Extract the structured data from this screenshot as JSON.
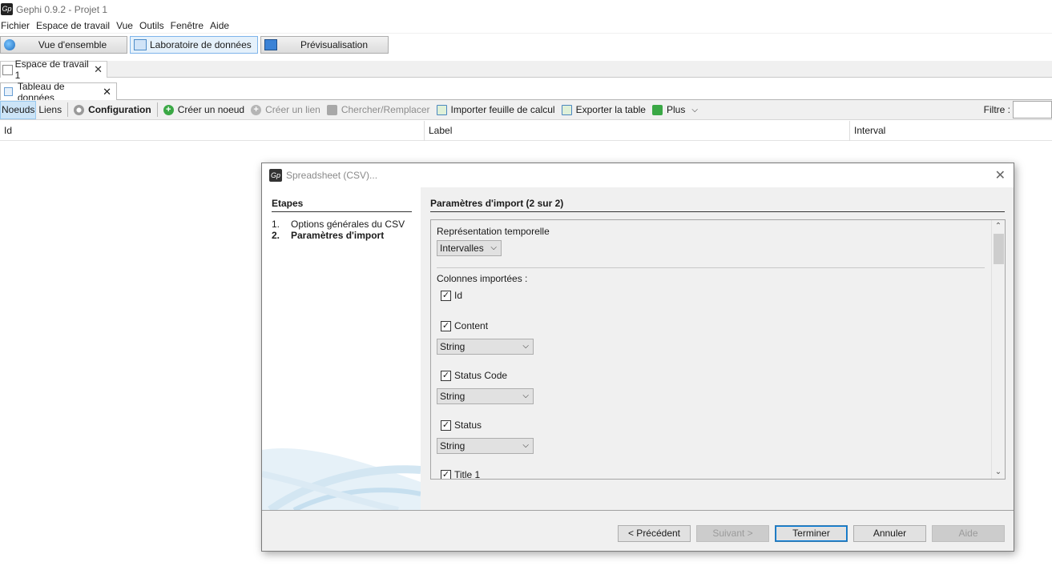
{
  "window": {
    "title": "Gephi 0.9.2 - Projet 1",
    "logo_text": "Gp"
  },
  "menu": [
    "Fichier",
    "Espace de travail",
    "Vue",
    "Outils",
    "Fenêtre",
    "Aide"
  ],
  "perspectives": [
    "Vue d'ensemble",
    "Laboratoire de données",
    "Prévisualisation"
  ],
  "workspace_tab": "Espace de travail 1",
  "data_tab": "Tableau de données",
  "toolbar": {
    "nodes": "Noeuds",
    "edges": "Liens",
    "configuration": "Configuration",
    "create_node": "Créer un noeud",
    "create_edge": "Créer un lien",
    "search_replace": "Chercher/Remplacer",
    "import_sheet": "Importer feuille de calcul",
    "export_table": "Exporter la table",
    "more": "Plus",
    "filter_label": "Filtre :"
  },
  "table_columns": [
    "Id",
    "Label",
    "Interval"
  ],
  "dialog": {
    "title": "Spreadsheet (CSV)...",
    "logo_text": "Gp",
    "steps_title": "Etapes",
    "steps": [
      {
        "num": "1.",
        "label": "Options générales du CSV"
      },
      {
        "num": "2.",
        "label": "Paramètres d'import"
      }
    ],
    "params_title": "Paramètres d'import (2 sur 2)",
    "temporal_label": "Représentation temporelle",
    "temporal_value": "Intervalles",
    "columns_label": "Colonnes importées :",
    "columns": [
      {
        "name": "Id",
        "checked": "✓",
        "type": ""
      },
      {
        "name": "Content",
        "checked": "✓",
        "type": "String"
      },
      {
        "name": "Status Code",
        "checked": "✓",
        "type": "String"
      },
      {
        "name": "Status",
        "checked": "✓",
        "type": "String"
      },
      {
        "name": "Title 1",
        "checked": "✓",
        "type": ""
      }
    ],
    "buttons": {
      "prev": "< Précédent",
      "next": "Suivant >",
      "finish": "Terminer",
      "cancel": "Annuler",
      "help": "Aide"
    }
  }
}
